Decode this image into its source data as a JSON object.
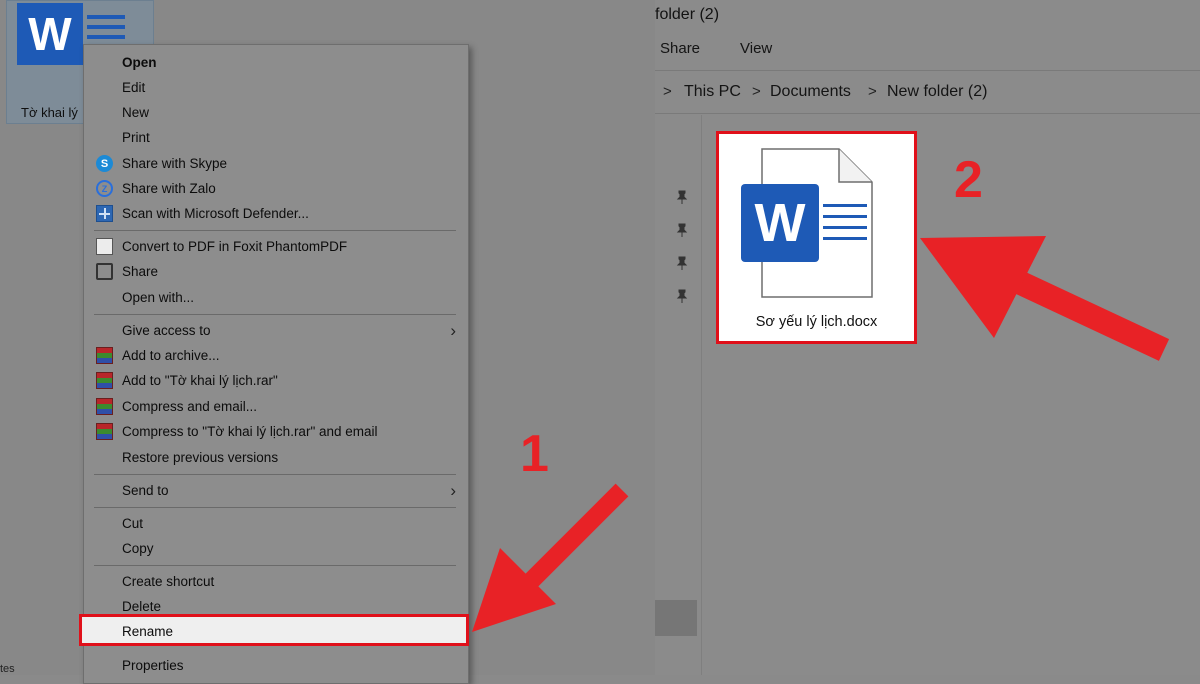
{
  "desktop": {
    "file_label": "Tờ khai lý",
    "word_letter": "W",
    "bottom_edge_text": "tes"
  },
  "context_menu": {
    "items": [
      {
        "label": "Open",
        "icon": "none",
        "bold": true
      },
      {
        "label": "Edit",
        "icon": "none"
      },
      {
        "label": "New",
        "icon": "none"
      },
      {
        "label": "Print",
        "icon": "none"
      },
      {
        "label": "Share with Skype",
        "icon": "skype-icon"
      },
      {
        "label": "Share with Zalo",
        "icon": "zalo-icon"
      },
      {
        "label": "Scan with Microsoft Defender...",
        "icon": "defender-icon"
      },
      {
        "label": "Convert to PDF in Foxit PhantomPDF",
        "icon": "foxit-icon"
      },
      {
        "label": "Share",
        "icon": "share-icon"
      },
      {
        "label": "Open with...",
        "icon": "none"
      },
      {
        "label": "Give access to",
        "icon": "none",
        "submenu": true
      },
      {
        "label": "Add to archive...",
        "icon": "winrar-icon"
      },
      {
        "label": "Add to \"Tờ khai lý lịch.rar\"",
        "icon": "winrar-icon"
      },
      {
        "label": "Compress and email...",
        "icon": "winrar-icon"
      },
      {
        "label": "Compress to \"Tờ khai lý lịch.rar\" and email",
        "icon": "winrar-icon"
      },
      {
        "label": "Restore previous versions",
        "icon": "none"
      },
      {
        "label": "Send to",
        "icon": "none",
        "submenu": true
      },
      {
        "label": "Cut",
        "icon": "none"
      },
      {
        "label": "Copy",
        "icon": "none"
      },
      {
        "label": "Create shortcut",
        "icon": "none"
      },
      {
        "label": "Delete",
        "icon": "none"
      },
      {
        "label": "Rename",
        "icon": "none",
        "highlighted": true
      },
      {
        "label": "Properties",
        "icon": "none"
      }
    ],
    "submenu_glyph": "›"
  },
  "explorer": {
    "window_title": "folder (2)",
    "ribbon_tabs": [
      "Share",
      "View"
    ],
    "breadcrumb": [
      "This PC",
      "Documents",
      "New folder (2)"
    ],
    "breadcrumb_separator": ">",
    "file": {
      "name": "Sơ yếu lý lịch.docx",
      "word_letter": "W"
    }
  },
  "annotations": {
    "step_1": "1",
    "step_2": "2",
    "highlight_color": "#e0101a",
    "arrow_color": "#e82226"
  },
  "colors": {
    "word_blue": "#1e5ab6"
  }
}
